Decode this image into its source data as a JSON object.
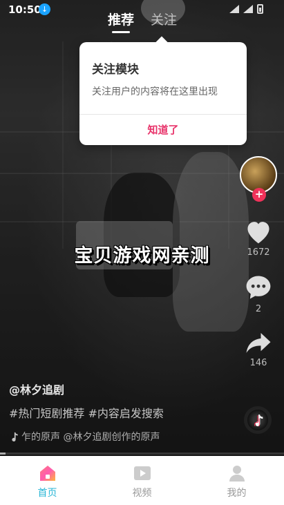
{
  "status_bar": {
    "time": "10:50"
  },
  "top_tabs": [
    {
      "label": "推荐",
      "active": true
    },
    {
      "label": "关注",
      "active": false
    }
  ],
  "popover": {
    "title": "关注模块",
    "body": "关注用户的内容将在这里出现",
    "button": "知道了"
  },
  "side_actions": {
    "like_count": "1672",
    "comment_count": "2",
    "share_count": "146"
  },
  "watermark": "宝贝游戏网亲测",
  "caption": {
    "author": "@林夕追剧",
    "tags": "#热门短剧推荐 #内容启发搜索",
    "music": "乍的原声    @林夕追剧创作的原声"
  },
  "bottom_nav": [
    {
      "label": "首页",
      "icon": "home-icon",
      "active": true
    },
    {
      "label": "视频",
      "icon": "video-icon",
      "active": false
    },
    {
      "label": "我的",
      "icon": "profile-icon",
      "active": false
    }
  ],
  "colors": {
    "accent": "#e8336a",
    "nav_active": "#29b6d6",
    "follow_plus": "#f0325a"
  }
}
